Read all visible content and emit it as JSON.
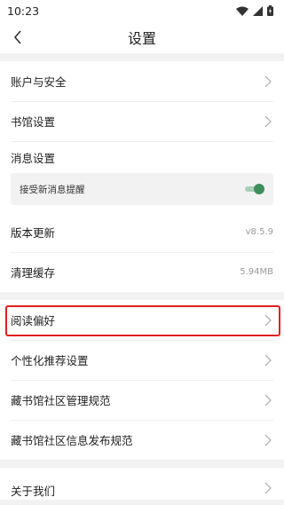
{
  "status_bar": {
    "time": "10:23"
  },
  "header": {
    "title": "设置"
  },
  "sections": {
    "account": [
      {
        "label": "账户与安全"
      },
      {
        "label": "书馆设置"
      }
    ],
    "message": {
      "title": "消息设置",
      "toggle_label": "接受新消息提醒",
      "toggle_on": true
    },
    "system": [
      {
        "label": "版本更新",
        "value": "v8.5.9"
      },
      {
        "label": "清理缓存",
        "value": "5.94MB"
      }
    ],
    "prefs": [
      {
        "label": "阅读偏好",
        "highlighted": true
      },
      {
        "label": "个性化推荐设置"
      },
      {
        "label": "藏书馆社区管理规范"
      },
      {
        "label": "藏书馆社区信息发布规范"
      }
    ],
    "about": [
      {
        "label": "关于我们"
      }
    ]
  },
  "colors": {
    "accent": "#3d8f5b",
    "highlight": "#e02020"
  }
}
